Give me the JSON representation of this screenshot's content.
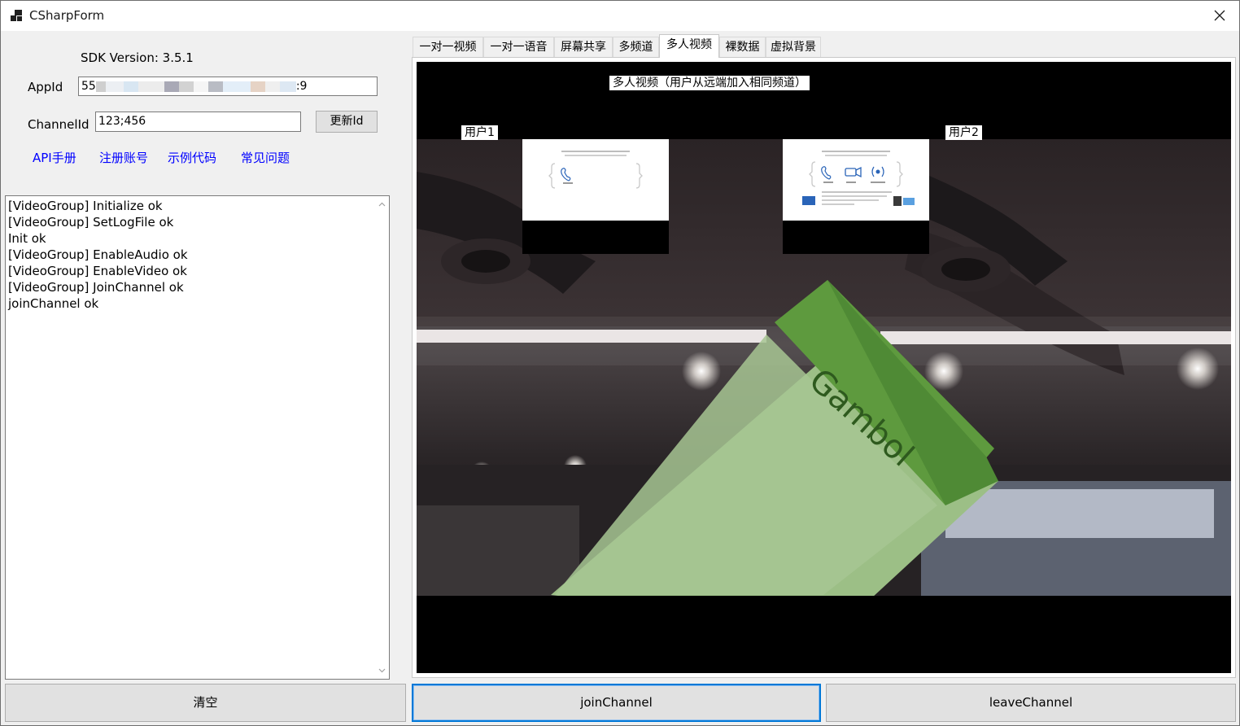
{
  "window": {
    "title": "CSharpForm"
  },
  "sdk": {
    "version_label": "SDK Version: 3.5.1"
  },
  "appid": {
    "label": "AppId",
    "value_start": "55",
    "value_end": ":9"
  },
  "channel": {
    "label": "ChannelId",
    "value": "123;456",
    "update_button": "更新Id"
  },
  "links": [
    "API手册",
    "注册账号",
    "示例代码",
    "常见问题"
  ],
  "log": {
    "lines": [
      "[VideoGroup] Initialize ok",
      "[VideoGroup] SetLogFile ok",
      "Init ok",
      "[VideoGroup] EnableAudio ok",
      "[VideoGroup] EnableVideo ok",
      "[VideoGroup] JoinChannel ok",
      "joinChannel ok"
    ]
  },
  "tabs": [
    {
      "label": "一对一视频",
      "active": false
    },
    {
      "label": "一对一语音",
      "active": false
    },
    {
      "label": "屏幕共享",
      "active": false
    },
    {
      "label": "多频道",
      "active": false
    },
    {
      "label": "多人视频",
      "active": true
    },
    {
      "label": "裸数据",
      "active": false
    },
    {
      "label": "虚拟背景",
      "active": false
    }
  ],
  "video": {
    "caption": "多人视频（用户从远端加入相同频道）",
    "user1_label": "用户1",
    "user2_label": "用户2"
  },
  "buttons": {
    "clear": "清空",
    "join": "joinChannel",
    "leave": "leaveChannel"
  }
}
